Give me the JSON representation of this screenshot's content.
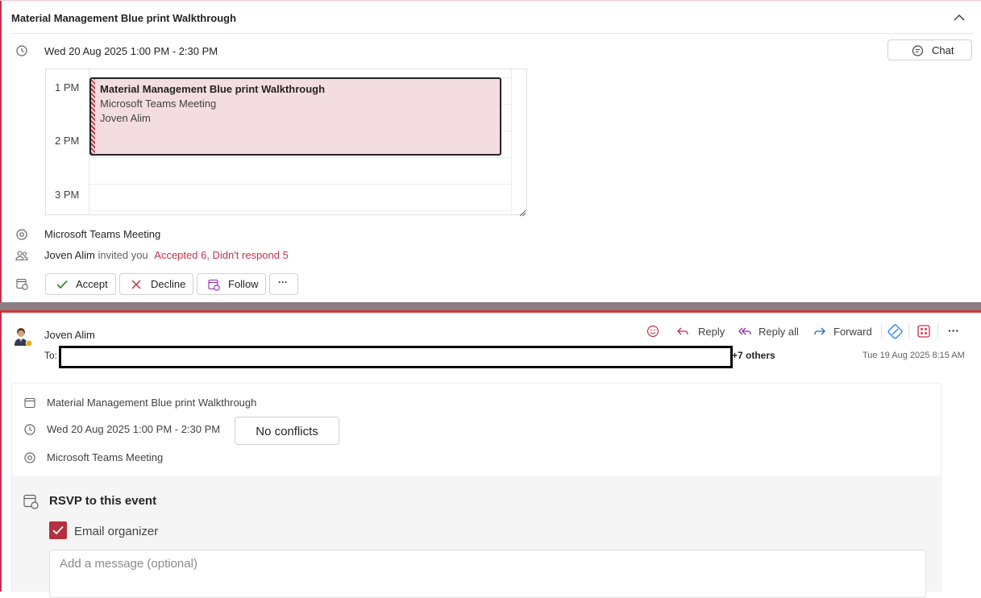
{
  "colors": {
    "accent_red": "#c4314b",
    "event_fill": "#f4dde0",
    "checkbox_fill": "#b4303f",
    "divider_gray": "#8a7d84",
    "divider_red": "#d13438",
    "link_blue": "#0f6cbd",
    "panel_gray": "#f5f5f5"
  },
  "meeting_card": {
    "title": "Material Management Blue  print Walkthrough",
    "datetime": "Wed 20 Aug 2025 1:00 PM - 2:30 PM",
    "chat_label": "Chat",
    "calendar": {
      "hours": [
        "1 PM",
        "2 PM",
        "3 PM"
      ],
      "event": {
        "title": "Material Management Blue print Walkthrough",
        "subtitle": "Microsoft Teams Meeting",
        "organizer": "Joven Alim"
      }
    },
    "location": "Microsoft Teams Meeting",
    "organizer_name": "Joven Alim",
    "invited_text": "invited you",
    "response_summary": "Accepted 6, Didn't respond 5",
    "actions": {
      "accept": "Accept",
      "decline": "Decline",
      "follow": "Follow",
      "more": "···"
    }
  },
  "email": {
    "sender": "Joven Alim",
    "to_label": "To:",
    "others": "+7 others",
    "sent_time": "Tue 19 Aug 2025 8:15 AM",
    "toolbar": {
      "reply": "Reply",
      "reply_all": "Reply all",
      "forward": "Forward",
      "more": "···"
    },
    "details": {
      "subject": "Material Management Blue print Walkthrough",
      "datetime": "Wed 20 Aug 2025 1:00 PM - 2:30 PM",
      "conflicts": "No conflicts",
      "location": "Microsoft Teams Meeting"
    },
    "rsvp": {
      "title": "RSVP to this event",
      "email_organizer_label": "Email organizer",
      "email_organizer_checked": true,
      "message_placeholder": "Add a message (optional)"
    }
  },
  "icons": {
    "collapse": "chevron-up-icon",
    "time": "clock-icon",
    "chat": "chat-bubble-icon",
    "location": "location-pin-icon",
    "attendees": "people-icon",
    "rsvp": "calendar-respond-icon",
    "accept": "checkmark-icon",
    "decline": "x-icon",
    "follow": "calendar-follow-icon",
    "emoji": "smiley-icon",
    "reply": "reply-arrow-icon",
    "reply_all": "reply-all-arrow-icon",
    "forward": "forward-arrow-icon",
    "loop": "loop-icon",
    "apps": "apps-grid-icon",
    "subject": "calendar-icon"
  }
}
